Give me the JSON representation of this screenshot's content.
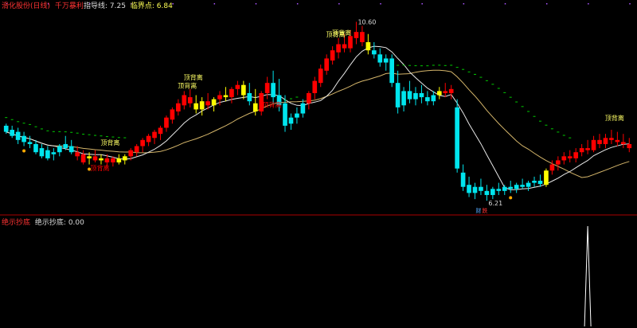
{
  "header": {
    "stock": "滑化股份(日线)",
    "strategy": "千万暴利",
    "indicator1_label": "指导线:",
    "indicator1_value": "7.25",
    "indicator2_label": "临界点:",
    "indicator2_value": "6.84"
  },
  "lower_header": {
    "name": "绝示抄底",
    "label": "绝示抄底:",
    "value": "0.00"
  },
  "colors": {
    "up": "#ff0000",
    "down": "#00e5ee",
    "signal": "#ffff00",
    "ma_slow": "#d4b56a",
    "ma_fast": "#e8e8e8",
    "dash": "#00cc00",
    "divider": "#aa0000",
    "label": "#ffff66"
  },
  "chart_data": [
    {
      "type": "candlestick",
      "title": "",
      "ylim": [
        5.9,
        10.9
      ],
      "annotations": {
        "high_label": "10.60",
        "low_label": "6.21",
        "warn_label": "顶背离",
        "buy_label": "抄底",
        "bottom_marks": [
          "财",
          "跌"
        ]
      },
      "candles": [
        {
          "o": 8.05,
          "h": 8.1,
          "l": 7.85,
          "c": 7.9,
          "k": "down"
        },
        {
          "o": 7.95,
          "h": 8.05,
          "l": 7.75,
          "c": 7.8,
          "k": "down"
        },
        {
          "o": 7.9,
          "h": 8.0,
          "l": 7.6,
          "c": 7.7,
          "k": "down"
        },
        {
          "o": 7.8,
          "h": 7.9,
          "l": 7.55,
          "c": 7.65,
          "k": "down"
        },
        {
          "o": 7.65,
          "h": 7.8,
          "l": 7.5,
          "c": 7.6,
          "k": "down"
        },
        {
          "o": 7.6,
          "h": 7.7,
          "l": 7.35,
          "c": 7.4,
          "k": "down"
        },
        {
          "o": 7.5,
          "h": 7.6,
          "l": 7.25,
          "c": 7.3,
          "k": "down"
        },
        {
          "o": 7.45,
          "h": 7.55,
          "l": 7.2,
          "c": 7.25,
          "k": "down"
        },
        {
          "o": 7.35,
          "h": 7.5,
          "l": 7.2,
          "c": 7.4,
          "k": "down"
        },
        {
          "o": 7.4,
          "h": 7.6,
          "l": 7.3,
          "c": 7.55,
          "k": "down"
        },
        {
          "o": 7.6,
          "h": 7.8,
          "l": 7.45,
          "c": 7.5,
          "k": "down"
        },
        {
          "o": 7.55,
          "h": 7.7,
          "l": 7.35,
          "c": 7.4,
          "k": "down"
        },
        {
          "o": 7.4,
          "h": 7.55,
          "l": 7.2,
          "c": 7.3,
          "k": "up"
        },
        {
          "o": 7.35,
          "h": 7.45,
          "l": 7.1,
          "c": 7.15,
          "k": "up"
        },
        {
          "o": 7.25,
          "h": 7.4,
          "l": 7.1,
          "c": 7.3,
          "k": "yellow"
        },
        {
          "o": 7.3,
          "h": 7.45,
          "l": 7.15,
          "c": 7.2,
          "k": "up"
        },
        {
          "o": 7.2,
          "h": 7.35,
          "l": 7.1,
          "c": 7.25,
          "k": "yellow"
        },
        {
          "o": 7.25,
          "h": 7.35,
          "l": 7.05,
          "c": 7.15,
          "k": "up"
        },
        {
          "o": 7.15,
          "h": 7.3,
          "l": 7.05,
          "c": 7.25,
          "k": "up"
        },
        {
          "o": 7.25,
          "h": 7.35,
          "l": 7.1,
          "c": 7.15,
          "k": "yellow"
        },
        {
          "o": 7.2,
          "h": 7.35,
          "l": 7.1,
          "c": 7.3,
          "k": "yellow"
        },
        {
          "o": 7.3,
          "h": 7.5,
          "l": 7.2,
          "c": 7.45,
          "k": "up"
        },
        {
          "o": 7.4,
          "h": 7.6,
          "l": 7.3,
          "c": 7.55,
          "k": "up"
        },
        {
          "o": 7.55,
          "h": 7.75,
          "l": 7.4,
          "c": 7.7,
          "k": "up"
        },
        {
          "o": 7.65,
          "h": 7.85,
          "l": 7.55,
          "c": 7.8,
          "k": "up"
        },
        {
          "o": 7.75,
          "h": 7.95,
          "l": 7.6,
          "c": 7.9,
          "k": "up"
        },
        {
          "o": 7.85,
          "h": 8.05,
          "l": 7.7,
          "c": 8.0,
          "k": "up"
        },
        {
          "o": 8.0,
          "h": 8.3,
          "l": 7.9,
          "c": 8.25,
          "k": "up"
        },
        {
          "o": 8.2,
          "h": 8.5,
          "l": 8.1,
          "c": 8.45,
          "k": "up"
        },
        {
          "o": 8.4,
          "h": 8.7,
          "l": 8.3,
          "c": 8.6,
          "k": "up"
        },
        {
          "o": 8.55,
          "h": 8.9,
          "l": 8.45,
          "c": 8.8,
          "k": "up"
        },
        {
          "o": 8.75,
          "h": 8.95,
          "l": 8.5,
          "c": 8.6,
          "k": "up"
        },
        {
          "o": 8.6,
          "h": 8.8,
          "l": 8.35,
          "c": 8.45,
          "k": "yellow"
        },
        {
          "o": 8.45,
          "h": 8.75,
          "l": 8.3,
          "c": 8.65,
          "k": "yellow"
        },
        {
          "o": 8.65,
          "h": 8.85,
          "l": 8.45,
          "c": 8.55,
          "k": "up"
        },
        {
          "o": 8.55,
          "h": 8.75,
          "l": 8.4,
          "c": 8.7,
          "k": "yellow"
        },
        {
          "o": 8.7,
          "h": 8.9,
          "l": 8.55,
          "c": 8.8,
          "k": "up"
        },
        {
          "o": 8.8,
          "h": 9.0,
          "l": 8.65,
          "c": 8.75,
          "k": "yellow"
        },
        {
          "o": 8.75,
          "h": 9.0,
          "l": 8.6,
          "c": 8.95,
          "k": "up"
        },
        {
          "o": 8.95,
          "h": 9.15,
          "l": 8.8,
          "c": 9.05,
          "k": "up"
        },
        {
          "o": 9.05,
          "h": 9.15,
          "l": 8.7,
          "c": 8.8,
          "k": "yellow"
        },
        {
          "o": 8.85,
          "h": 9.1,
          "l": 8.55,
          "c": 8.65,
          "k": "down"
        },
        {
          "o": 8.6,
          "h": 8.95,
          "l": 8.3,
          "c": 8.4,
          "k": "yellow"
        },
        {
          "o": 8.4,
          "h": 8.9,
          "l": 8.3,
          "c": 8.85,
          "k": "up"
        },
        {
          "o": 8.85,
          "h": 9.25,
          "l": 8.7,
          "c": 9.1,
          "k": "up"
        },
        {
          "o": 9.1,
          "h": 9.4,
          "l": 8.6,
          "c": 8.75,
          "k": "down"
        },
        {
          "o": 8.8,
          "h": 9.2,
          "l": 8.4,
          "c": 8.55,
          "k": "down"
        },
        {
          "o": 8.6,
          "h": 8.8,
          "l": 7.9,
          "c": 8.05,
          "k": "down"
        },
        {
          "o": 8.1,
          "h": 8.35,
          "l": 7.95,
          "c": 8.25,
          "k": "down"
        },
        {
          "o": 8.25,
          "h": 8.5,
          "l": 8.1,
          "c": 8.35,
          "k": "down"
        },
        {
          "o": 8.35,
          "h": 8.7,
          "l": 8.25,
          "c": 8.6,
          "k": "down"
        },
        {
          "o": 8.6,
          "h": 8.9,
          "l": 8.45,
          "c": 8.85,
          "k": "up"
        },
        {
          "o": 8.85,
          "h": 9.25,
          "l": 8.7,
          "c": 9.15,
          "k": "up"
        },
        {
          "o": 9.1,
          "h": 9.55,
          "l": 9.0,
          "c": 9.45,
          "k": "up"
        },
        {
          "o": 9.4,
          "h": 9.8,
          "l": 9.3,
          "c": 9.7,
          "k": "up"
        },
        {
          "o": 9.65,
          "h": 10.0,
          "l": 9.55,
          "c": 9.9,
          "k": "up"
        },
        {
          "o": 9.85,
          "h": 10.2,
          "l": 9.7,
          "c": 10.05,
          "k": "up"
        },
        {
          "o": 10.05,
          "h": 10.3,
          "l": 9.85,
          "c": 9.95,
          "k": "up"
        },
        {
          "o": 9.95,
          "h": 10.4,
          "l": 9.85,
          "c": 10.25,
          "k": "up"
        },
        {
          "o": 10.2,
          "h": 10.6,
          "l": 10.05,
          "c": 10.35,
          "k": "up"
        },
        {
          "o": 10.35,
          "h": 10.5,
          "l": 10.0,
          "c": 10.1,
          "k": "up"
        },
        {
          "o": 10.1,
          "h": 10.3,
          "l": 9.8,
          "c": 9.9,
          "k": "yellow"
        },
        {
          "o": 9.9,
          "h": 10.1,
          "l": 9.7,
          "c": 9.8,
          "k": "down"
        },
        {
          "o": 9.8,
          "h": 9.95,
          "l": 9.5,
          "c": 9.6,
          "k": "down"
        },
        {
          "o": 9.6,
          "h": 9.8,
          "l": 9.4,
          "c": 9.7,
          "k": "down"
        },
        {
          "o": 9.7,
          "h": 9.8,
          "l": 9.0,
          "c": 9.1,
          "k": "down"
        },
        {
          "o": 9.1,
          "h": 9.4,
          "l": 8.35,
          "c": 8.5,
          "k": "down"
        },
        {
          "o": 8.55,
          "h": 9.0,
          "l": 8.4,
          "c": 8.9,
          "k": "down"
        },
        {
          "o": 8.9,
          "h": 9.15,
          "l": 8.6,
          "c": 8.7,
          "k": "down"
        },
        {
          "o": 8.7,
          "h": 9.0,
          "l": 8.55,
          "c": 8.85,
          "k": "down"
        },
        {
          "o": 8.85,
          "h": 9.05,
          "l": 8.6,
          "c": 8.75,
          "k": "down"
        },
        {
          "o": 8.75,
          "h": 8.9,
          "l": 8.55,
          "c": 8.65,
          "k": "down"
        },
        {
          "o": 8.65,
          "h": 8.9,
          "l": 8.55,
          "c": 8.8,
          "k": "down"
        },
        {
          "o": 8.8,
          "h": 9.0,
          "l": 8.7,
          "c": 8.9,
          "k": "yellow"
        },
        {
          "o": 8.9,
          "h": 9.1,
          "l": 8.75,
          "c": 8.85,
          "k": "up"
        },
        {
          "o": 8.85,
          "h": 9.05,
          "l": 8.7,
          "c": 8.95,
          "k": "up"
        },
        {
          "o": 8.5,
          "h": 8.7,
          "l": 6.9,
          "c": 7.0,
          "k": "down"
        },
        {
          "o": 6.9,
          "h": 7.1,
          "l": 6.45,
          "c": 6.55,
          "k": "down"
        },
        {
          "o": 6.6,
          "h": 6.8,
          "l": 6.3,
          "c": 6.4,
          "k": "down"
        },
        {
          "o": 6.4,
          "h": 6.65,
          "l": 6.25,
          "c": 6.55,
          "k": "down"
        },
        {
          "o": 6.55,
          "h": 6.75,
          "l": 6.35,
          "c": 6.45,
          "k": "down"
        },
        {
          "o": 6.45,
          "h": 6.6,
          "l": 6.21,
          "c": 6.35,
          "k": "down"
        },
        {
          "o": 6.35,
          "h": 6.55,
          "l": 6.25,
          "c": 6.5,
          "k": "down"
        },
        {
          "o": 6.5,
          "h": 6.65,
          "l": 6.35,
          "c": 6.45,
          "k": "down"
        },
        {
          "o": 6.45,
          "h": 6.6,
          "l": 6.35,
          "c": 6.55,
          "k": "down"
        },
        {
          "o": 6.55,
          "h": 6.7,
          "l": 6.4,
          "c": 6.5,
          "k": "down"
        },
        {
          "o": 6.5,
          "h": 6.65,
          "l": 6.4,
          "c": 6.6,
          "k": "down"
        },
        {
          "o": 6.6,
          "h": 6.75,
          "l": 6.5,
          "c": 6.55,
          "k": "down"
        },
        {
          "o": 6.55,
          "h": 6.7,
          "l": 6.45,
          "c": 6.65,
          "k": "down"
        },
        {
          "o": 6.65,
          "h": 6.8,
          "l": 6.55,
          "c": 6.7,
          "k": "down"
        },
        {
          "o": 6.7,
          "h": 6.85,
          "l": 6.55,
          "c": 6.62,
          "k": "down"
        },
        {
          "o": 6.6,
          "h": 7.0,
          "l": 6.55,
          "c": 6.95,
          "k": "yellow"
        },
        {
          "o": 6.95,
          "h": 7.2,
          "l": 6.85,
          "c": 7.1,
          "k": "up"
        },
        {
          "o": 7.1,
          "h": 7.3,
          "l": 6.95,
          "c": 7.2,
          "k": "up"
        },
        {
          "o": 7.2,
          "h": 7.4,
          "l": 7.1,
          "c": 7.3,
          "k": "up"
        },
        {
          "o": 7.3,
          "h": 7.45,
          "l": 7.15,
          "c": 7.25,
          "k": "up"
        },
        {
          "o": 7.25,
          "h": 7.5,
          "l": 7.15,
          "c": 7.4,
          "k": "up"
        },
        {
          "o": 7.4,
          "h": 7.6,
          "l": 7.3,
          "c": 7.5,
          "k": "up"
        },
        {
          "o": 7.5,
          "h": 7.7,
          "l": 7.35,
          "c": 7.45,
          "k": "up"
        },
        {
          "o": 7.45,
          "h": 7.8,
          "l": 7.4,
          "c": 7.7,
          "k": "up"
        },
        {
          "o": 7.7,
          "h": 7.85,
          "l": 7.5,
          "c": 7.6,
          "k": "up"
        },
        {
          "o": 7.6,
          "h": 7.85,
          "l": 7.5,
          "c": 7.75,
          "k": "up"
        },
        {
          "o": 7.75,
          "h": 7.95,
          "l": 7.6,
          "c": 7.7,
          "k": "up"
        },
        {
          "o": 7.7,
          "h": 7.9,
          "l": 7.55,
          "c": 7.65,
          "k": "up"
        },
        {
          "o": 7.65,
          "h": 7.85,
          "l": 7.5,
          "c": 7.6,
          "k": "up"
        },
        {
          "o": 7.6,
          "h": 7.75,
          "l": 7.4,
          "c": 7.5,
          "k": "up"
        }
      ]
    },
    {
      "type": "line",
      "title": "",
      "ylim": [
        0,
        1
      ],
      "peak_index": 98,
      "peak_value": 1
    }
  ]
}
